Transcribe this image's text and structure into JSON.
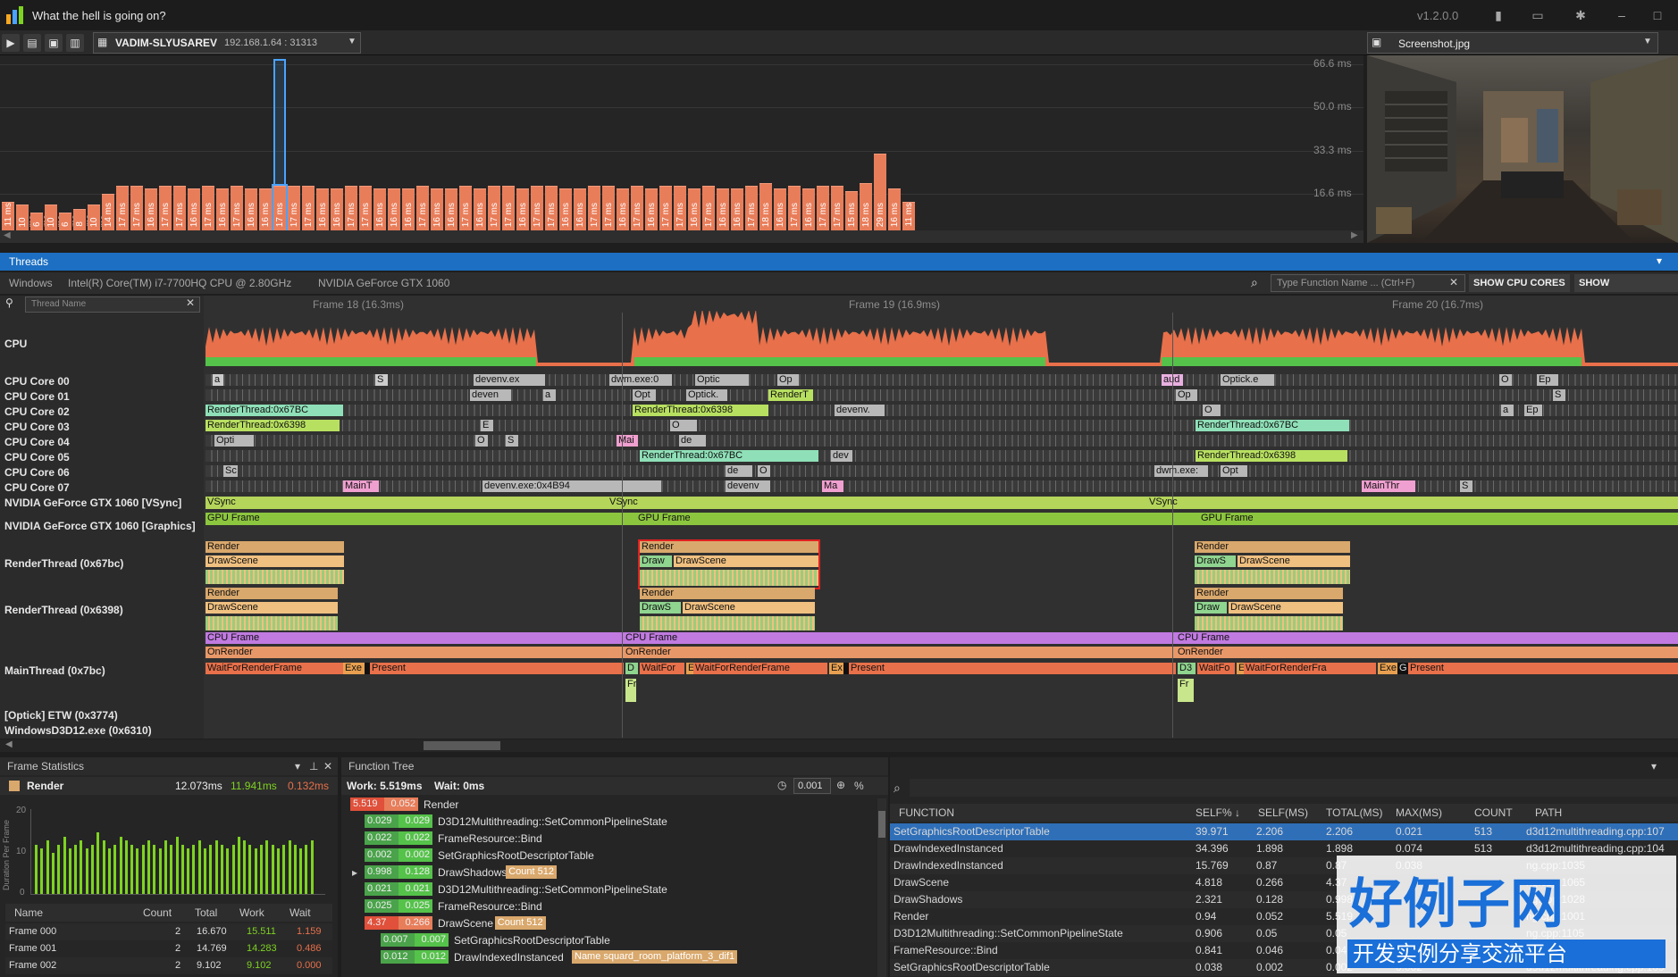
{
  "app": {
    "title": "What the hell is going on?",
    "version": "v1.2.0.0"
  },
  "toolbar": {
    "target_name": "VADIM-SLYUSAREV",
    "target_ip": "192.168.1.64 : 31313",
    "screenshot_name": "Screenshot.jpg"
  },
  "frames_chart": {
    "y_labels": [
      "66.6 ms",
      "50.0 ms",
      "33.3 ms",
      "16.6 ms"
    ],
    "bars": [
      {
        "label": "11 ms",
        "value": 11
      },
      {
        "label": "10 ms",
        "value": 10
      },
      {
        "label": "6 ms",
        "value": 6
      },
      {
        "label": "10 ms",
        "value": 10
      },
      {
        "label": "6 ms",
        "value": 6
      },
      {
        "label": "8 ms",
        "value": 8
      },
      {
        "label": "10 ms",
        "value": 10
      },
      {
        "label": "14 ms",
        "value": 14
      },
      {
        "label": "17 ms",
        "value": 17
      },
      {
        "label": "17 ms",
        "value": 17
      },
      {
        "label": "16 ms",
        "value": 16
      },
      {
        "label": "17 ms",
        "value": 17
      },
      {
        "label": "17 ms",
        "value": 17
      },
      {
        "label": "16 ms",
        "value": 16
      },
      {
        "label": "17 ms",
        "value": 17
      },
      {
        "label": "16 ms",
        "value": 16
      },
      {
        "label": "17 ms",
        "value": 17
      },
      {
        "label": "16 ms",
        "value": 16
      },
      {
        "label": "16 ms",
        "value": 16
      },
      {
        "label": "17 ms",
        "value": 17
      },
      {
        "label": "17 ms",
        "value": 17
      },
      {
        "label": "17 ms",
        "value": 17
      },
      {
        "label": "16 ms",
        "value": 16
      },
      {
        "label": "16 ms",
        "value": 16
      },
      {
        "label": "17 ms",
        "value": 17
      },
      {
        "label": "17 ms",
        "value": 17
      },
      {
        "label": "16 ms",
        "value": 16
      },
      {
        "label": "16 ms",
        "value": 16
      },
      {
        "label": "16 ms",
        "value": 16
      },
      {
        "label": "17 ms",
        "value": 17
      },
      {
        "label": "16 ms",
        "value": 16
      },
      {
        "label": "16 ms",
        "value": 16
      },
      {
        "label": "17 ms",
        "value": 17
      },
      {
        "label": "16 ms",
        "value": 16
      },
      {
        "label": "17 ms",
        "value": 17
      },
      {
        "label": "17 ms",
        "value": 17
      },
      {
        "label": "16 ms",
        "value": 16
      },
      {
        "label": "17 ms",
        "value": 17
      },
      {
        "label": "17 ms",
        "value": 17
      },
      {
        "label": "16 ms",
        "value": 16
      },
      {
        "label": "16 ms",
        "value": 16
      },
      {
        "label": "17 ms",
        "value": 17
      },
      {
        "label": "17 ms",
        "value": 17
      },
      {
        "label": "16 ms",
        "value": 16
      },
      {
        "label": "17 ms",
        "value": 17
      },
      {
        "label": "16 ms",
        "value": 16
      },
      {
        "label": "17 ms",
        "value": 17
      },
      {
        "label": "17 ms",
        "value": 17
      },
      {
        "label": "16 ms",
        "value": 16
      },
      {
        "label": "17 ms",
        "value": 17
      },
      {
        "label": "16 ms",
        "value": 16
      },
      {
        "label": "16 ms",
        "value": 16
      },
      {
        "label": "17 ms",
        "value": 17
      },
      {
        "label": "18 ms",
        "value": 18
      },
      {
        "label": "16 ms",
        "value": 16
      },
      {
        "label": "17 ms",
        "value": 17
      },
      {
        "label": "16 ms",
        "value": 16
      },
      {
        "label": "17 ms",
        "value": 17
      },
      {
        "label": "17 ms",
        "value": 17
      },
      {
        "label": "15 ms",
        "value": 15
      },
      {
        "label": "18 ms",
        "value": 18
      },
      {
        "label": "29 ms",
        "value": 29
      },
      {
        "label": "16 ms",
        "value": 16
      },
      {
        "label": "11 ms",
        "value": 11
      }
    ],
    "selected_index": 19
  },
  "threads": {
    "header": "Threads",
    "info": [
      "Windows",
      "Intel(R) Core(TM) i7-7700HQ CPU @ 2.80GHz",
      "NVIDIA GeForce GTX 1060"
    ],
    "search_placeholder": "Type Function Name ... (Ctrl+F)",
    "show_cpu_cores": "SHOW CPU CORES",
    "show_callstacks": "SHOW CALLSTACKS",
    "thread_filter_placeholder": "Thread Name",
    "frame_labels": [
      "Frame 18 (16.3ms)",
      "Frame 19 (16.9ms)",
      "Frame 20 (16.7ms)"
    ],
    "rows": [
      "CPU",
      "CPU Core 00",
      "CPU Core 01",
      "CPU Core 02",
      "CPU Core 03",
      "CPU Core 04",
      "CPU Core 05",
      "CPU Core 06",
      "CPU Core 07",
      "NVIDIA GeForce GTX 1060 [VSync]",
      "NVIDIA GeForce GTX 1060 [Graphics]",
      "RenderThread (0x67bc)",
      "RenderThread (0x6398)",
      "MainThread (0x7bc)",
      "[Optick] ETW (0x3774)",
      "WindowsD3D12.exe (0x6310)"
    ],
    "core_blocks": {
      "c00": [
        "a",
        "S",
        "devenv.ex",
        "dwm.exe:0",
        "Optic",
        "Op",
        "aud",
        "Optick.e",
        "O",
        "Ep"
      ],
      "c01": [
        "deven",
        "a",
        "Opt",
        "Optick.",
        "RenderT",
        "Op",
        "S"
      ],
      "c02": [
        "RenderThread:0x67BC",
        "RenderThread:0x6398",
        "devenv.",
        "O",
        "a",
        "Ep"
      ],
      "c03": [
        "RenderThread:0x6398",
        "E",
        "O",
        "RenderThread:0x67BC"
      ],
      "c04": [
        "Opti",
        "O",
        "S",
        "Mai",
        "de"
      ],
      "c05": [
        "RenderThread:0x67BC",
        "dev",
        "RenderThread:0x6398"
      ],
      "c06": [
        "Sc",
        "de",
        "O",
        "dwm.exe:",
        "Opt"
      ],
      "c07": [
        "MainT",
        "devenv.exe:0x4B94",
        "devenv",
        "Ma",
        "MainThr",
        "S"
      ]
    },
    "vsync_label": "VSync",
    "gpu_frame_label": "GPU Frame",
    "render_labels": {
      "render": "Render",
      "drawscene": "DrawScene",
      "draw": "Draw",
      "draws": "DrawS",
      "cpu_frame": "CPU Frame",
      "on_render": "OnRender",
      "wait_for_render_frame": "WaitForRenderFrame",
      "wait_for_render_fra": "WaitForRenderFra",
      "wait_for": "WaitFor",
      "waitfo": "WaitFo",
      "present": "Present",
      "exe": "Exe",
      "ex": "Ex",
      "d": "D",
      "d3": "D3",
      "e": "E",
      "fr": "Fr",
      "g": "G"
    }
  },
  "frame_statistics": {
    "title": "Frame Statistics",
    "item": "Render",
    "total": "12.073ms",
    "work": "11.941ms",
    "wait": "0.132ms",
    "y_axis_label": "Duration Per Frame",
    "y_ticks": [
      "20",
      "10",
      "0"
    ],
    "histogram": [
      12,
      11,
      13,
      10,
      12,
      14,
      11,
      12,
      13,
      11,
      12,
      15,
      13,
      11,
      12,
      14,
      13,
      12,
      11,
      12,
      13,
      12,
      11,
      13,
      12,
      14,
      12,
      11,
      12,
      13,
      11,
      12,
      13,
      12,
      11,
      12,
      14,
      13,
      12,
      11,
      12,
      13,
      12,
      11,
      12,
      13,
      12,
      11,
      12,
      13
    ],
    "columns": [
      "Name",
      "Count",
      "Total",
      "Work",
      "Wait"
    ],
    "rows": [
      {
        "name": "Frame 000",
        "count": "2",
        "total": "16.670",
        "work": "15.511",
        "wait": "1.159"
      },
      {
        "name": "Frame 001",
        "count": "2",
        "total": "14.769",
        "work": "14.283",
        "wait": "0.486"
      },
      {
        "name": "Frame 002",
        "count": "2",
        "total": "9.102",
        "work": "9.102",
        "wait": "0.000"
      }
    ]
  },
  "function_tree": {
    "title": "Function Tree",
    "work": "Work: 5.519ms",
    "wait": "Wait: 0ms",
    "threshold": "0.001",
    "percent": "%",
    "rows": [
      {
        "indent": 0,
        "a": "5.519",
        "b": "0.052",
        "name": "Render",
        "tag": ""
      },
      {
        "indent": 1,
        "a": "0.029",
        "b": "0.029",
        "name": "D3D12Multithreading::SetCommonPipelineState",
        "tag": ""
      },
      {
        "indent": 1,
        "a": "0.022",
        "b": "0.022",
        "name": "FrameResource::Bind",
        "tag": ""
      },
      {
        "indent": 1,
        "a": "0.002",
        "b": "0.002",
        "name": "SetGraphicsRootDescriptorTable",
        "tag": ""
      },
      {
        "indent": 1,
        "a": "0.998",
        "b": "0.128",
        "name": "DrawShadows",
        "tag": "Count 512"
      },
      {
        "indent": 1,
        "a": "0.021",
        "b": "0.021",
        "name": "D3D12Multithreading::SetCommonPipelineState",
        "tag": ""
      },
      {
        "indent": 1,
        "a": "0.025",
        "b": "0.025",
        "name": "FrameResource::Bind",
        "tag": ""
      },
      {
        "indent": 1,
        "a": "4.37",
        "b": "0.266",
        "name": "DrawScene",
        "tag": "Count 512"
      },
      {
        "indent": 2,
        "a": "0.007",
        "b": "0.007",
        "name": "SetGraphicsRootDescriptorTable",
        "tag": ""
      },
      {
        "indent": 2,
        "a": "0.012",
        "b": "0.012",
        "name": "DrawIndexedInstanced",
        "tag": "Name squard_room_platform_3_dif1"
      }
    ]
  },
  "function_table": {
    "columns": [
      "FUNCTION",
      "SELF% ↓",
      "SELF(MS)",
      "TOTAL(MS)",
      "MAX(MS)",
      "COUNT",
      "PATH"
    ],
    "rows": [
      {
        "fn": "SetGraphicsRootDescriptorTable",
        "self_pct": "39.971",
        "self_ms": "2.206",
        "total": "2.206",
        "max": "0.021",
        "count": "513",
        "path": "d3d12multithreading.cpp:107"
      },
      {
        "fn": "DrawIndexedInstanced",
        "self_pct": "34.396",
        "self_ms": "1.898",
        "total": "1.898",
        "max": "0.074",
        "count": "513",
        "path": "d3d12multithreading.cpp:104"
      },
      {
        "fn": "DrawIndexedInstanced",
        "self_pct": "15.769",
        "self_ms": "0.87",
        "total": "0.87",
        "max": "0.038",
        "count": "",
        "path": "ng.cpp:1035"
      },
      {
        "fn": "DrawScene",
        "self_pct": "4.818",
        "self_ms": "0.266",
        "total": "4.37",
        "max": "",
        "count": "",
        "path": "ng.cpp:1065"
      },
      {
        "fn": "DrawShadows",
        "self_pct": "2.321",
        "self_ms": "0.128",
        "total": "0.998",
        "max": "",
        "count": "",
        "path": "ng.cpp:1028"
      },
      {
        "fn": "Render",
        "self_pct": "0.94",
        "self_ms": "0.052",
        "total": "5.519",
        "max": "",
        "count": "",
        "path": "ng.cpp:1001"
      },
      {
        "fn": "D3D12Multithreading::SetCommonPipelineState",
        "self_pct": "0.906",
        "self_ms": "0.05",
        "total": "0.05",
        "max": "",
        "count": "",
        "path": "ng.cpp:1105"
      },
      {
        "fn": "FrameResource::Bind",
        "self_pct": "0.841",
        "self_ms": "0.046",
        "total": "0.046",
        "max": "",
        "count": "",
        "path": "287"
      },
      {
        "fn": "SetGraphicsRootDescriptorTable",
        "self_pct": "0.038",
        "self_ms": "0.002",
        "total": "0.002",
        "max": "0.002",
        "count": "",
        "path": "d3d12multithreading.cpp:109"
      }
    ]
  },
  "watermark": {
    "main": "好例子网",
    "sub": "开发实例分享交流平台"
  },
  "colors": {
    "accent": "#1c6fc2",
    "frame_bar": "#e87d5a",
    "vsync": "#9acd32",
    "render": "#d9a86c",
    "drawscene": "#f0c080",
    "cpu_frame": "#c07ae0",
    "wait": "#e8704a"
  }
}
